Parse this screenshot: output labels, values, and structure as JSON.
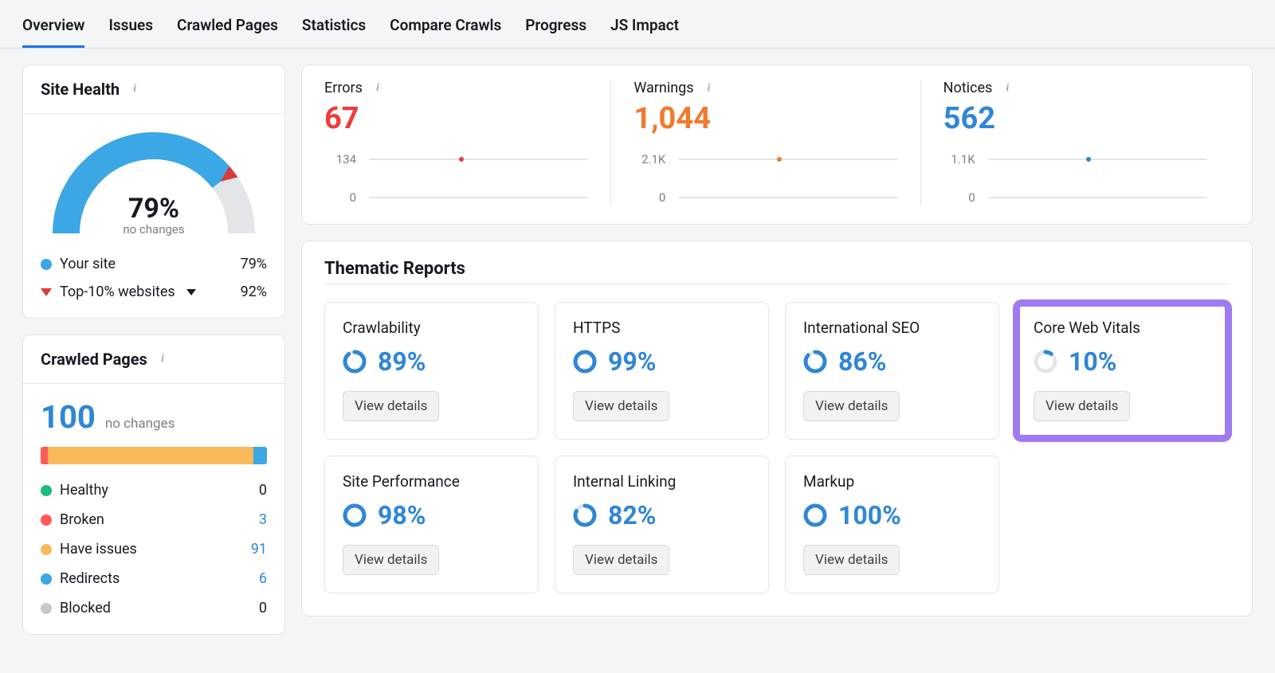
{
  "tabs": [
    "Overview",
    "Issues",
    "Crawled Pages",
    "Statistics",
    "Compare Crawls",
    "Progress",
    "JS Impact"
  ],
  "active_tab": 0,
  "site_health": {
    "title": "Site Health",
    "percent": "79%",
    "subtitle": "no changes",
    "gauge_value": 79,
    "legend": {
      "your_site_label": "Your site",
      "your_site_value": "79%",
      "top10_label": "Top-10% websites",
      "top10_value": "92%"
    }
  },
  "crawled_pages": {
    "title": "Crawled Pages",
    "total": "100",
    "subtitle": "no changes",
    "bar_segments": [
      {
        "color": "#ff5a5a",
        "width": 3
      },
      {
        "color": "#f9b85c",
        "width": 91
      },
      {
        "color": "#3ba7e5",
        "width": 6
      }
    ],
    "rows": [
      {
        "label": "Healthy",
        "value": "0",
        "dot": "dot-green",
        "muted": true
      },
      {
        "label": "Broken",
        "value": "3",
        "dot": "dot-red"
      },
      {
        "label": "Have issues",
        "value": "91",
        "dot": "dot-amber"
      },
      {
        "label": "Redirects",
        "value": "6",
        "dot": "dot-blue"
      },
      {
        "label": "Blocked",
        "value": "0",
        "dot": "dot-gray",
        "muted": true
      }
    ]
  },
  "summary": {
    "cols": [
      {
        "title": "Errors",
        "value": "67",
        "cls": "sum-errors",
        "top": "134",
        "bot": "0",
        "dot_color": "#ef3b3b",
        "dot_pos": 42
      },
      {
        "title": "Warnings",
        "value": "1,044",
        "cls": "sum-warnings",
        "top": "2.1K",
        "bot": "0",
        "dot_color": "#ef7b2d",
        "dot_pos": 46
      },
      {
        "title": "Notices",
        "value": "562",
        "cls": "sum-notices",
        "top": "1.1K",
        "bot": "0",
        "dot_color": "#2f86d6",
        "dot_pos": 46
      }
    ]
  },
  "thematic": {
    "title": "Thematic Reports",
    "reports": [
      {
        "name": "Crawlability",
        "percent": 89,
        "label": "89%",
        "btn": "View details"
      },
      {
        "name": "HTTPS",
        "percent": 99,
        "label": "99%",
        "btn": "View details"
      },
      {
        "name": "International SEO",
        "percent": 86,
        "label": "86%",
        "btn": "View details"
      },
      {
        "name": "Core Web Vitals",
        "percent": 10,
        "label": "10%",
        "btn": "View details",
        "highlight": true
      },
      {
        "name": "Site Performance",
        "percent": 98,
        "label": "98%",
        "btn": "View details"
      },
      {
        "name": "Internal Linking",
        "percent": 82,
        "label": "82%",
        "btn": "View details"
      },
      {
        "name": "Markup",
        "percent": 100,
        "label": "100%",
        "btn": "View details"
      }
    ]
  },
  "chart_data": [
    {
      "type": "bar",
      "title": "Site Health gauge",
      "categories": [
        "Your site",
        "Top-10% websites"
      ],
      "values": [
        79,
        92
      ],
      "ylim": [
        0,
        100
      ]
    },
    {
      "type": "bar",
      "title": "Crawled Pages breakdown",
      "categories": [
        "Healthy",
        "Broken",
        "Have issues",
        "Redirects",
        "Blocked"
      ],
      "values": [
        0,
        3,
        91,
        6,
        0
      ]
    }
  ]
}
